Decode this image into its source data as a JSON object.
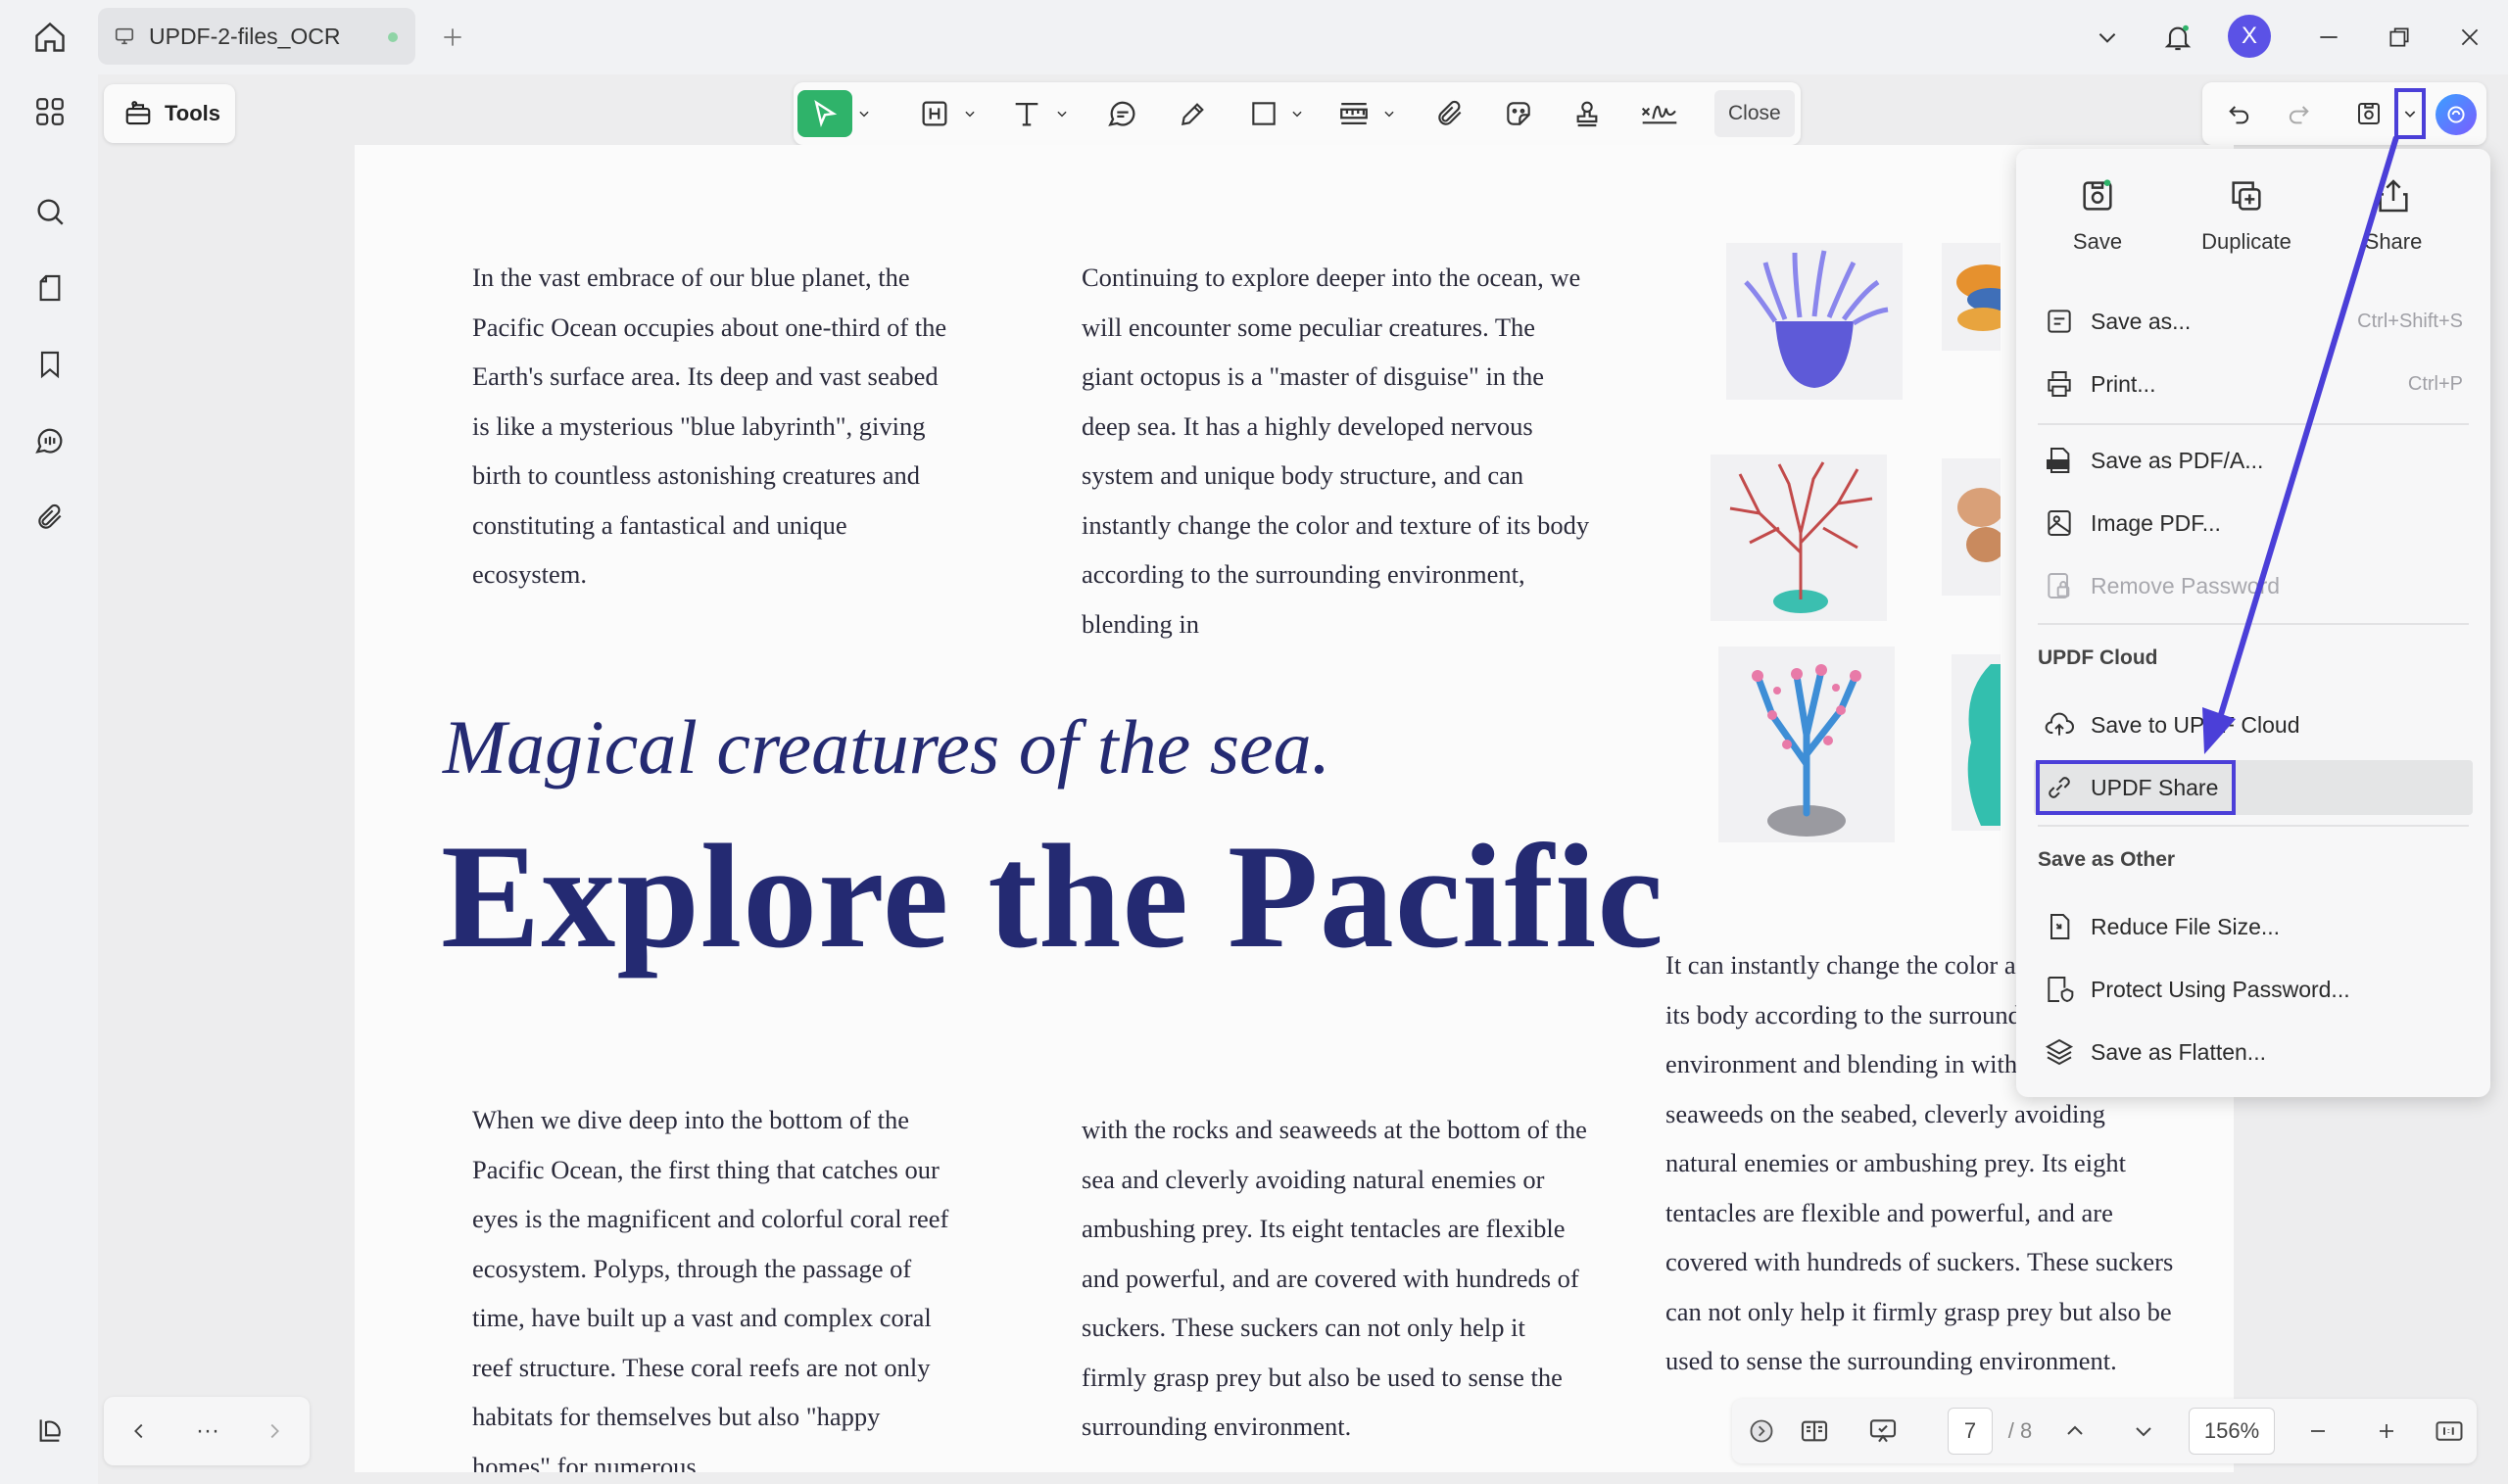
{
  "titlebar": {
    "tab_title": "UPDF-2-files_OCR",
    "avatar_letter": "X"
  },
  "tools": {
    "label": "Tools"
  },
  "toolbar": {
    "close_label": "Close"
  },
  "document": {
    "col1_top": "In the vast embrace of our blue planet, the Pacific Ocean occupies about one-third of the Earth's surface area. Its deep and vast seabed is like a mysterious \"blue labyrinth\", giving birth to countless astonishing creatures and constituting a fantastical and unique ecosystem.",
    "col2_top": "Continuing to explore deeper into the ocean, we will encounter some peculiar creatures. The giant octopus is a \"master of disguise\" in the deep sea. It has a highly developed nervous system and unique body structure, and can instantly change the color and texture of its body according to the surrounding environment, blending in",
    "magical_title": "Magical creatures of the sea.",
    "big_title": "Explore the Pacific",
    "col1_bottom": "When we dive deep into the bottom of the Pacific Ocean, the first thing that catches our eyes is the magnificent and colorful coral reef ecosystem. Polyps, through the passage of time, have built up a vast and complex coral reef structure. These coral reefs are not only habitats for themselves but also \"happy homes\" for numerous",
    "col2_bottom": "with the rocks and seaweeds at the bottom of the sea and cleverly avoiding natural enemies or ambushing prey. Its eight tentacles are flexible and powerful, and are covered with hundreds of suckers. These suckers can not only help it firmly grasp prey but also be used to sense the surrounding environment.",
    "col3_bottom": "It can instantly change the color and texture of its body according to the surrounding environment and blending in with the rocks and seaweeds on the seabed, cleverly avoiding natural enemies or ambushing prey. Its eight tentacles are flexible and powerful, and are covered with hundreds of suckers. These suckers can not only help it firmly grasp prey but also be used to sense the surrounding environment."
  },
  "menu": {
    "save": "Save",
    "duplicate": "Duplicate",
    "share": "Share",
    "save_as": "Save as...",
    "save_as_shortcut": "Ctrl+Shift+S",
    "print": "Print...",
    "print_shortcut": "Ctrl+P",
    "save_as_pdfa": "Save as PDF/A...",
    "image_pdf": "Image PDF...",
    "remove_password": "Remove Password",
    "section_cloud": "UPDF Cloud",
    "save_to_cloud": "Save to UPDF Cloud",
    "updf_share": "UPDF Share",
    "section_other": "Save as Other",
    "reduce_size": "Reduce File Size...",
    "protect": "Protect Using Password...",
    "flatten": "Save as Flatten..."
  },
  "pagination": {
    "current_page": "7",
    "total_pages": "/ 8",
    "zoom": "156%",
    "more": "···"
  },
  "colors": {
    "accent": "#4b3fd8",
    "select_tool": "#2fb36a",
    "title_blue": "#242a72"
  }
}
